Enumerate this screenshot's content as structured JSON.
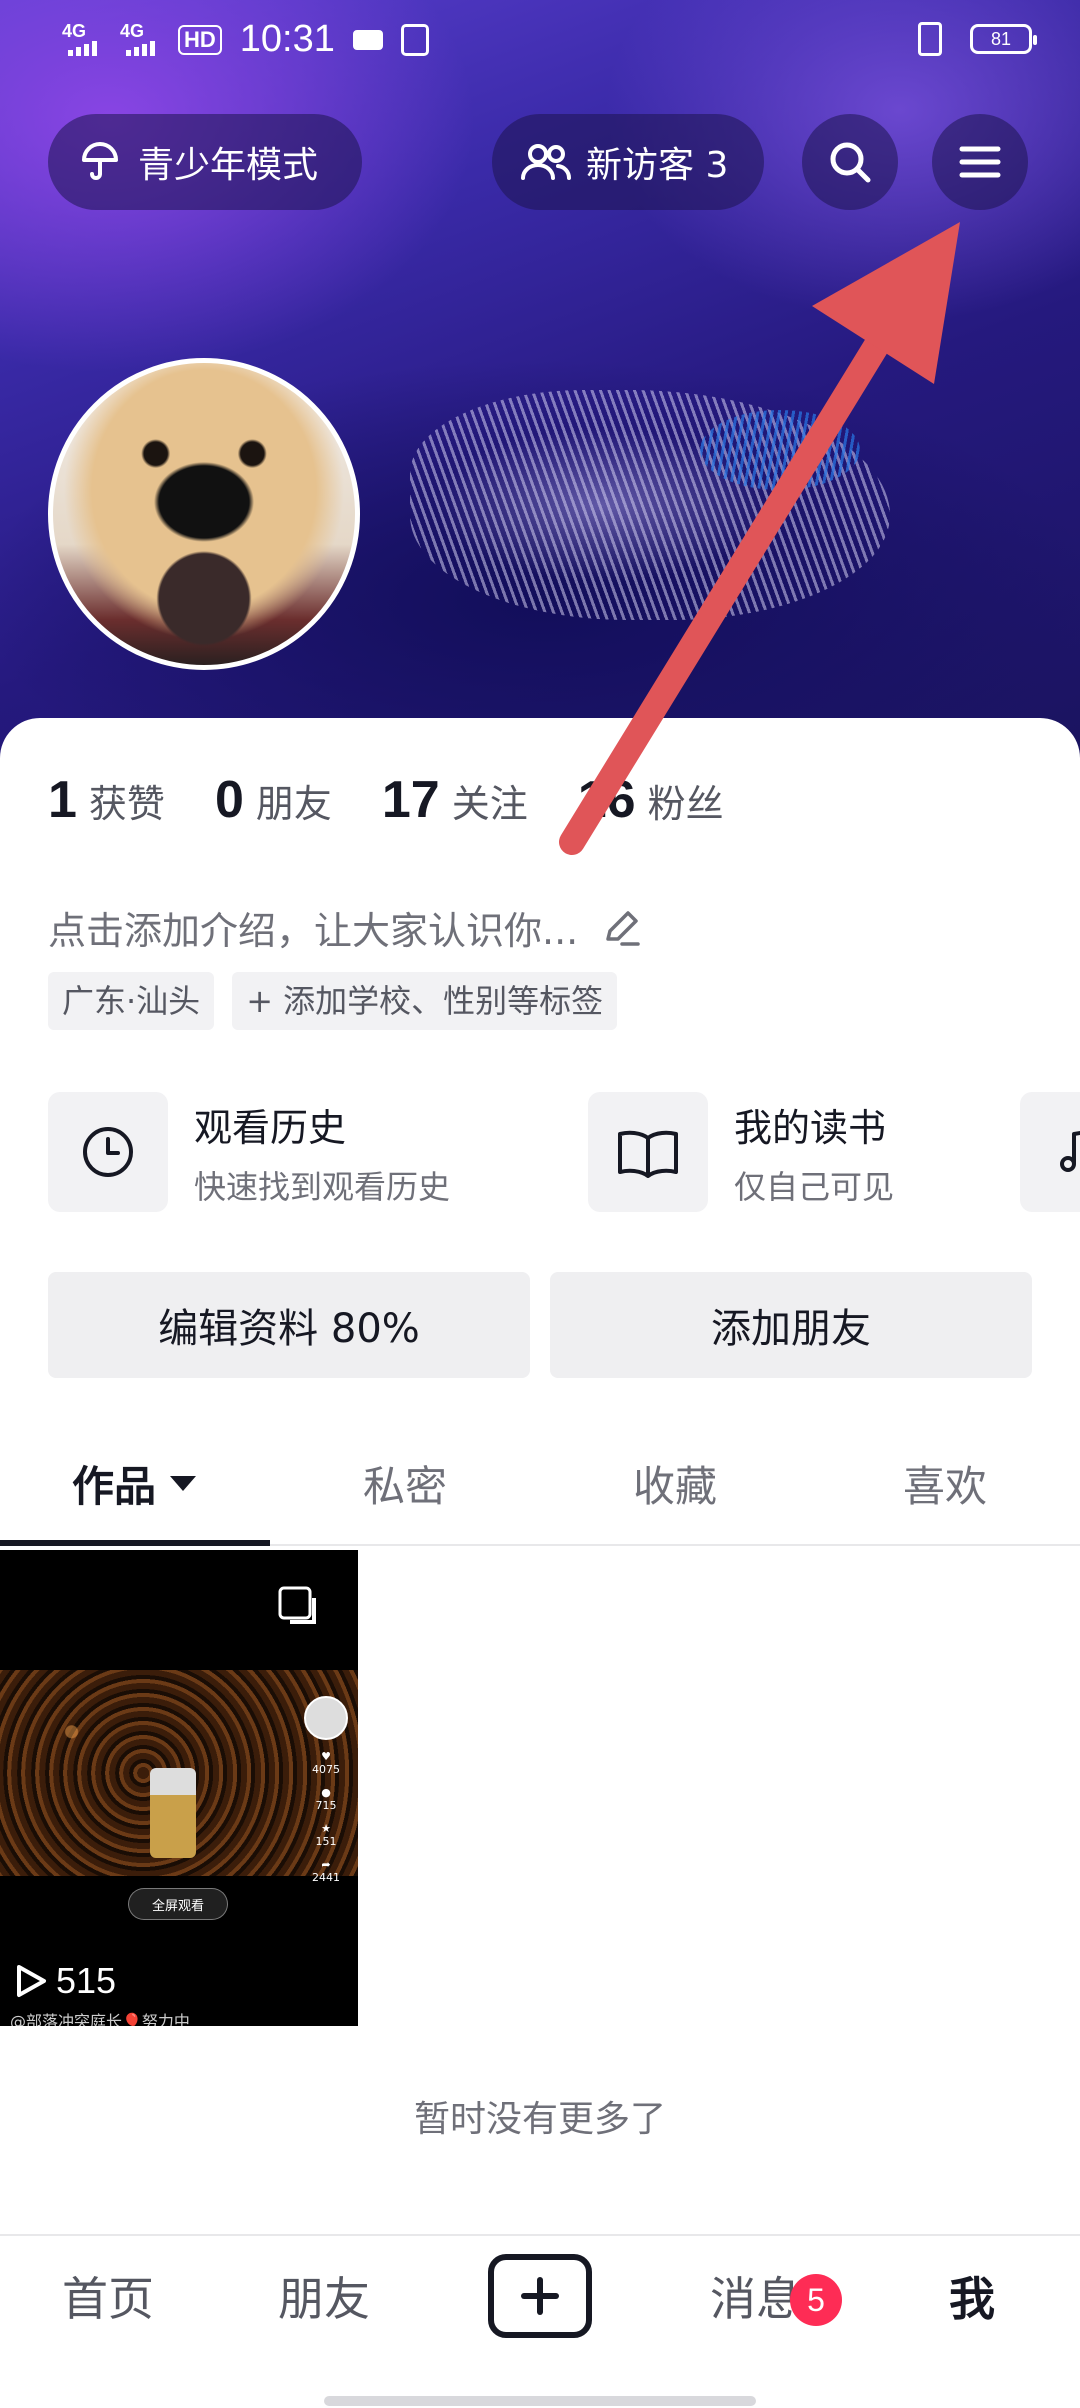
{
  "status_bar": {
    "net1": "4G",
    "net2": "4G",
    "hd": "HD",
    "time": "10:31",
    "battery": "81"
  },
  "header": {
    "teen_mode_label": "青少年模式",
    "visitors_label": "新访客 3"
  },
  "stats": [
    {
      "num": "1",
      "label": "获赞"
    },
    {
      "num": "0",
      "label": "朋友"
    },
    {
      "num": "17",
      "label": "关注"
    },
    {
      "num": "16",
      "label": "粉丝"
    }
  ],
  "bio": {
    "placeholder": "点击添加介绍，让大家认识你..."
  },
  "tags": [
    "广东·汕头",
    "+ 添加学校、性别等标签"
  ],
  "shortcuts": [
    {
      "title": "观看历史",
      "subtitle": "快速找到观看历史"
    },
    {
      "title": "我的读书",
      "subtitle": "仅自己可见"
    }
  ],
  "actions": {
    "edit_profile": "编辑资料 80%",
    "add_friends": "添加朋友"
  },
  "tabs": [
    {
      "label": "作品",
      "active": true
    },
    {
      "label": "私密"
    },
    {
      "label": "收藏"
    },
    {
      "label": "喜欢"
    }
  ],
  "video": {
    "plays": "515",
    "fullscreen_label": "全屏观看",
    "likes": "4075",
    "comments": "715",
    "favorites": "151",
    "shares": "2441",
    "caption": "@部落冲突庭长🎈努力中"
  },
  "no_more_text": "暂时没有更多了",
  "bottom_nav": {
    "home": "首页",
    "friends": "朋友",
    "messages": "消息",
    "messages_badge": "5",
    "me": "我"
  },
  "colors": {
    "accent": "#fe2c55",
    "annotation_arrow": "#e05558"
  }
}
